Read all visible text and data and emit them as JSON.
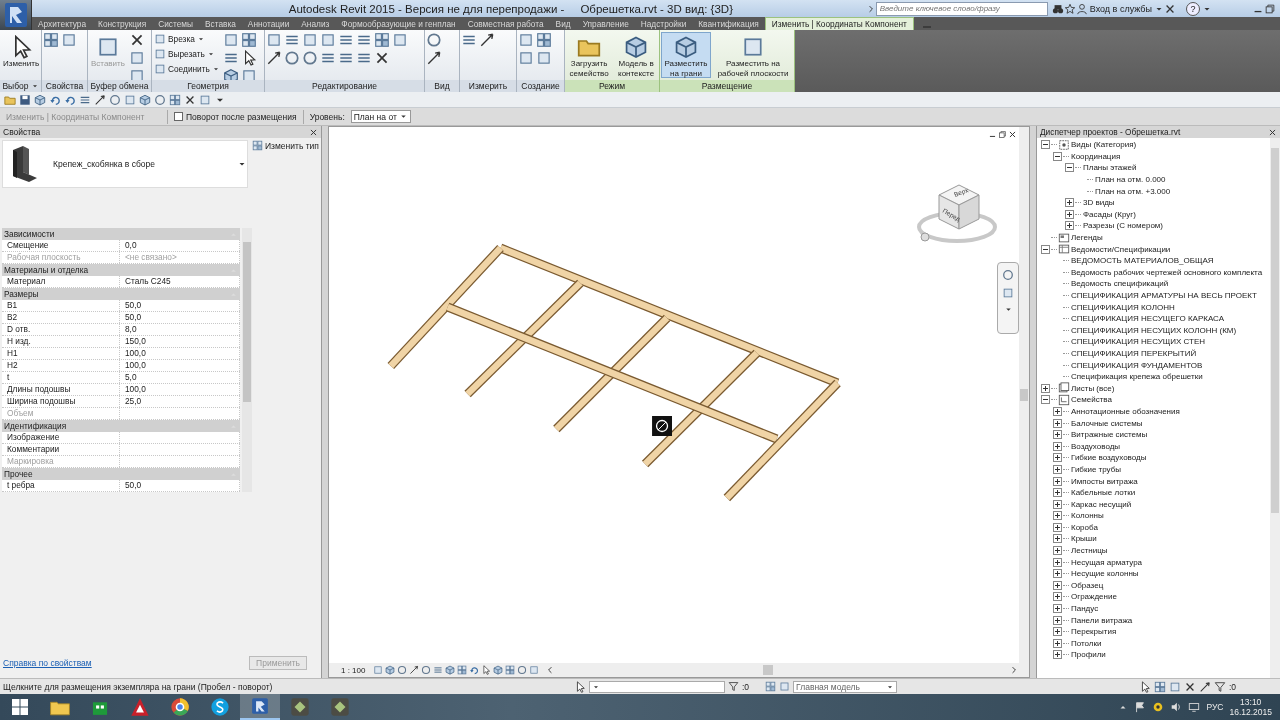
{
  "title_bar": {
    "app_title": "Autodesk Revit 2015 - Версия не для перепродажи -",
    "file_title": "Обрешетка.rvt - 3D вид: {3D}",
    "search_placeholder": "Введите ключевое слово/фразу",
    "sign_in": "Вход в службы",
    "help": "?"
  },
  "ribbon_tabs": [
    {
      "label": "Архитектура",
      "selected": false
    },
    {
      "label": "Конструкция",
      "selected": false
    },
    {
      "label": "Системы",
      "selected": false
    },
    {
      "label": "Вставка",
      "selected": false
    },
    {
      "label": "Аннотации",
      "selected": false
    },
    {
      "label": "Анализ",
      "selected": false
    },
    {
      "label": "Формообразующие и генплан",
      "selected": false
    },
    {
      "label": "Совместная работа",
      "selected": false
    },
    {
      "label": "Вид",
      "selected": false
    },
    {
      "label": "Управление",
      "selected": false
    },
    {
      "label": "Надстройки",
      "selected": false
    },
    {
      "label": "Квантификация",
      "selected": false
    },
    {
      "label": "Изменить | Координаты Компонент",
      "selected": true
    }
  ],
  "ribbon_panels": [
    {
      "kind": "select",
      "label": "Выбор",
      "buttons": [
        {
          "kind": "large",
          "label": "Изменить",
          "selected": false,
          "disabled": false
        }
      ]
    },
    {
      "kind": "properties",
      "label": "Свойства"
    },
    {
      "kind": "clipboard",
      "label": "Буфер обмена",
      "buttons": [
        {
          "kind": "large",
          "label": "Вставить",
          "selected": false,
          "disabled": true
        }
      ]
    },
    {
      "kind": "geometry",
      "label": "Геометрия",
      "buttons": [
        {
          "kind": "small",
          "label": "Врезка",
          "selected": false,
          "disabled": false
        },
        {
          "kind": "small",
          "label": "Вырезать",
          "selected": false,
          "disabled": false
        },
        {
          "kind": "small",
          "label": "Соединить",
          "selected": false,
          "disabled": false
        }
      ]
    },
    {
      "kind": "modify",
      "label": "Редактирование"
    },
    {
      "kind": "view",
      "label": "Вид"
    },
    {
      "kind": "measure",
      "label": "Измерить"
    },
    {
      "kind": "create",
      "label": "Создание"
    },
    {
      "kind": "mode",
      "label": "Режим",
      "buttons": [
        {
          "kind": "large",
          "label": "Загрузить семейство",
          "selected": false,
          "disabled": false
        },
        {
          "kind": "large",
          "label": "Модель в контексте",
          "selected": false,
          "disabled": false
        }
      ]
    },
    {
      "kind": "placement",
      "label": "Размещение",
      "buttons": [
        {
          "kind": "large",
          "label": "Разместить на грани",
          "selected": true,
          "disabled": false
        },
        {
          "kind": "large",
          "label": "Разместить на рабочей плоскости",
          "selected": false,
          "disabled": false
        }
      ]
    }
  ],
  "options_bar": {
    "context": "Изменить | Координаты Компонент",
    "rotate_after_placement": {
      "label": "Поворот после размещения",
      "checked": false
    },
    "level_label": "Уровень:",
    "level_value": "План на от"
  },
  "properties": {
    "title": "Свойства",
    "type_name": "Крепеж_скобянка в сборе",
    "edit_type": "Изменить тип",
    "groups": [
      {
        "name": "Зависимости",
        "rows": [
          {
            "name": "Смещение",
            "value": "0,0",
            "disabled": false
          },
          {
            "name": "Рабочая плоскость",
            "value": "<не связано>",
            "disabled": true
          }
        ]
      },
      {
        "name": "Материалы и отделка",
        "rows": [
          {
            "name": "Материал",
            "value": "Сталь С245",
            "disabled": false
          }
        ]
      },
      {
        "name": "Размеры",
        "rows": [
          {
            "name": "B1",
            "value": "50,0",
            "disabled": false
          },
          {
            "name": "B2",
            "value": "50,0",
            "disabled": false
          },
          {
            "name": "D отв.",
            "value": "8,0",
            "disabled": false
          },
          {
            "name": "H изд.",
            "value": "150,0",
            "disabled": false
          },
          {
            "name": "H1",
            "value": "100,0",
            "disabled": false
          },
          {
            "name": "H2",
            "value": "100,0",
            "disabled": false
          },
          {
            "name": "t",
            "value": "5,0",
            "disabled": false
          },
          {
            "name": "Длины подошвы",
            "value": "100,0",
            "disabled": false
          },
          {
            "name": "Ширина подошвы",
            "value": "25,0",
            "disabled": false
          },
          {
            "name": "Объем",
            "disabled": true
          }
        ]
      },
      {
        "name": "Идентификация",
        "rows": [
          {
            "name": "Изображение",
            "disabled": false
          },
          {
            "name": "Комментарии",
            "disabled": false
          },
          {
            "name": "Маркировка",
            "disabled": true
          }
        ]
      },
      {
        "name": "Прочее",
        "rows": [
          {
            "name": "t ребра",
            "value": "50,0",
            "disabled": false
          }
        ]
      }
    ],
    "help_link": "Справка по свойствам",
    "apply": {
      "label": "Применить",
      "disabled": true
    }
  },
  "view": {
    "cube_top": "Верх",
    "cube_front": "Перед",
    "scale": "1 : 100"
  },
  "browser": {
    "title": "Диспетчер проектов - Обрешетка.rvt",
    "tree": [
      {
        "kind": "views",
        "label": "Виды (Категория)",
        "expanded": true,
        "children": [
          {
            "label": "Координация",
            "expanded": true,
            "children": [
              {
                "label": "Планы этажей",
                "expanded": true,
                "children": [
                  {
                    "label": "План на отм. 0.000"
                  },
                  {
                    "label": "План на отм. +3.000"
                  }
                ]
              },
              {
                "label": "3D виды",
                "expanded": false
              },
              {
                "label": "Фасады (Круг)",
                "expanded": false
              },
              {
                "label": "Разрезы (С номером)",
                "expanded": false
              }
            ]
          }
        ]
      },
      {
        "kind": "legends",
        "label": "Легенды"
      },
      {
        "kind": "schedules",
        "label": "Ведомости/Спецификации",
        "expanded": true,
        "children": [
          {
            "label": "ВЕДОМОСТЬ МАТЕРИАЛОВ_ОБЩАЯ"
          },
          {
            "label": "Ведомость рабочих чертежей основного комплекта"
          },
          {
            "label": "Ведомость спецификаций"
          },
          {
            "label": "СПЕЦИФИКАЦИЯ АРМАТУРЫ НА ВЕСЬ ПРОЕКТ"
          },
          {
            "label": "СПЕЦИФИКАЦИЯ КОЛОНН"
          },
          {
            "label": "СПЕЦИФИКАЦИЯ НЕСУЩЕГО КАРКАСА"
          },
          {
            "label": "СПЕЦИФИКАЦИЯ НЕСУЩИХ КОЛОНН (КМ)"
          },
          {
            "label": "СПЕЦИФИКАЦИЯ НЕСУЩИХ СТЕН"
          },
          {
            "label": "СПЕЦИФИКАЦИЯ ПЕРЕКРЫТИЙ"
          },
          {
            "label": "СПЕЦИФИКАЦИЯ ФУНДАМЕНТОВ"
          },
          {
            "label": "Спецификация крепежа обрешетки"
          }
        ]
      },
      {
        "kind": "sheets",
        "label": "Листы (все)",
        "expanded": false
      },
      {
        "kind": "families",
        "label": "Семейства",
        "expanded": true,
        "children": [
          {
            "label": "Аннотационные обозначения",
            "expanded": false
          },
          {
            "label": "Балочные системы",
            "expanded": false
          },
          {
            "label": "Витражные системы",
            "expanded": false
          },
          {
            "label": "Воздуховоды",
            "expanded": false
          },
          {
            "label": "Гибкие воздуховоды",
            "expanded": false
          },
          {
            "label": "Гибкие трубы",
            "expanded": false
          },
          {
            "label": "Импосты витража",
            "expanded": false
          },
          {
            "label": "Кабельные лотки",
            "expanded": false
          },
          {
            "label": "Каркас несущий",
            "expanded": false
          },
          {
            "label": "Колонны",
            "expanded": false
          },
          {
            "label": "Короба",
            "expanded": false
          },
          {
            "label": "Крыши",
            "expanded": false
          },
          {
            "label": "Лестницы",
            "expanded": false
          },
          {
            "label": "Несущая арматура",
            "expanded": false
          },
          {
            "label": "Несущие колонны",
            "expanded": false
          },
          {
            "label": "Образец",
            "expanded": false
          },
          {
            "label": "Ограждение",
            "expanded": false
          },
          {
            "label": "Пандус",
            "expanded": false
          },
          {
            "label": "Панели витража",
            "expanded": false
          },
          {
            "label": "Перекрытия",
            "expanded": false
          },
          {
            "label": "Потолки",
            "expanded": false
          },
          {
            "label": "Профили",
            "expanded": false
          }
        ]
      }
    ]
  },
  "status_bar": {
    "hint": "Щелкните для размещения экземпляра на грани (Пробел - поворот)",
    "selection_count": ":0",
    "model": "Главная модель",
    "filter_count": ":0"
  },
  "taskbar": {
    "apps": [
      {
        "kind": "folder",
        "selected": false
      },
      {
        "kind": "store",
        "selected": false
      },
      {
        "kind": "autocad",
        "selected": false
      },
      {
        "kind": "browser",
        "selected": false
      },
      {
        "kind": "skype",
        "selected": false
      },
      {
        "kind": "revit",
        "selected": true
      },
      {
        "kind": "viewer",
        "selected": false
      },
      {
        "kind": "viewer",
        "selected": false
      }
    ],
    "language": "РУС",
    "time": "13:10",
    "date": "16.12.2015"
  }
}
